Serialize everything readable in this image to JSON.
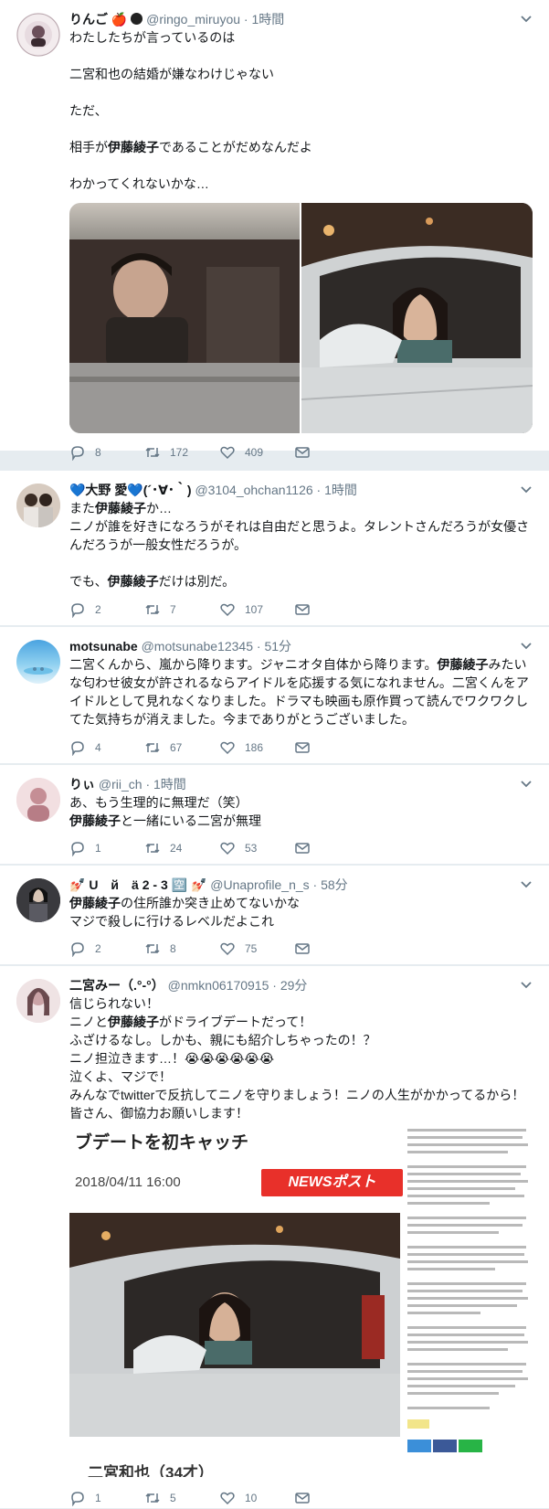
{
  "tweets": [
    {
      "name": "りんご",
      "name_emoji": "🍎",
      "handle": "@ringo_miruyou",
      "time": "1時間",
      "lines": [
        "わたしたちが言っているのは",
        "",
        "二宮和也の結婚が嫌なわけじゃない",
        "",
        "ただ、",
        "",
        "相手が伊藤綾子であることがだめなんだよ",
        "",
        "わかってくれないかな…"
      ],
      "replies": "8",
      "retweets": "172",
      "likes": "409"
    },
    {
      "name": "💙大野 愛💙(´･∀･｀)",
      "handle": "@3104_ohchan1126",
      "time": "1時間",
      "lines": [
        "また伊藤綾子か…",
        "ニノが誰を好きになろうがそれは自由だと思うよ。タレントさんだろうが女優さんだろうが一般女性だろうが。",
        "",
        "でも、伊藤綾子だけは別だ。"
      ],
      "replies": "2",
      "retweets": "7",
      "likes": "107"
    },
    {
      "name": "motsunabe",
      "handle": "@motsunabe12345",
      "time": "51分",
      "lines": [
        "二宮くんから、嵐から降ります。ジャニオタ自体から降ります。伊藤綾子みたいな匂わせ彼女が許されるならアイドルを応援する気になれません。二宮くんをアイドルとして見れなくなりました。ドラマも映画も原作買って読んでワクワクしてた気持ちが消えました。今までありがとうございました。"
      ],
      "replies": "4",
      "retweets": "67",
      "likes": "186"
    },
    {
      "name": "りぃ",
      "handle": "@rii_ch",
      "time": "1時間",
      "lines": [
        "あ、もう生理的に無理だ（笑）",
        "伊藤綾子と一緒にいる二宮が無理"
      ],
      "replies": "1",
      "retweets": "24",
      "likes": "53"
    },
    {
      "name": "💅🏻 U　й　ä 2 - 3 🈳 💅🏻",
      "handle": "@Unaprofile_n_s",
      "time": "58分",
      "lines": [
        "伊藤綾子の住所誰か突き止めてないかな",
        "マジで殺しに行けるレベルだよこれ"
      ],
      "replies": "2",
      "retweets": "8",
      "likes": "75"
    },
    {
      "name": "二宮みー（.°-°）",
      "handle": "@nmkn06170915",
      "time": "29分",
      "lines": [
        "信じられない！",
        "ニノと伊藤綾子がドライブデートだって！",
        "ふざけるなし。しかも、親にも紹介しちゃったの！？",
        "ニノ担泣きます…！😭😭😭😭😭😭",
        "泣くよ、マジで！",
        "みんなでtwitterで反抗してニノを守りましょう！ニノの人生がかかってるから！皆さん、御協力お願いします！"
      ],
      "replies": "1",
      "retweets": "5",
      "likes": "10"
    }
  ],
  "article": {
    "headline": "ブデートを初キャッチ",
    "date": "2018/04/11 16:00",
    "logo": "NEWSポスト",
    "footer": "二宮和也（34才）"
  },
  "colors": {
    "link": "#1da1f2",
    "muted": "#657786",
    "logo_red": "#e8302a"
  }
}
